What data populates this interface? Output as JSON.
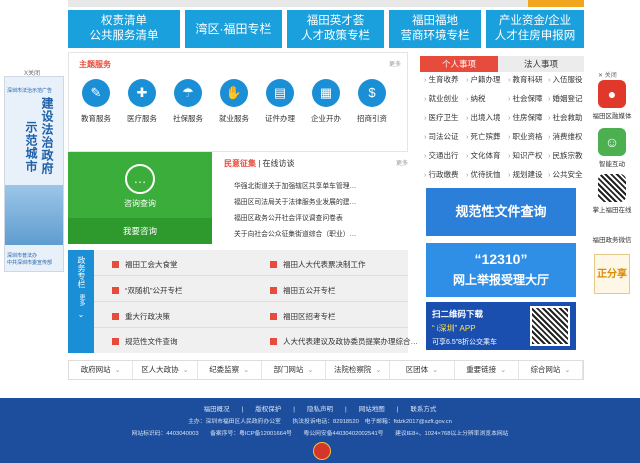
{
  "banners": [
    {
      "line1": "权责清单",
      "line2": "公共服务清单"
    },
    {
      "line1": "湾区·福田专栏",
      "line2": ""
    },
    {
      "line1": "福田英才荟",
      "line2": "人才政策专栏"
    },
    {
      "line1": "福田福地",
      "line2": "营商环境专栏"
    },
    {
      "line1": "产业资金/企业",
      "line2": "人才住房申报网"
    }
  ],
  "theme_services": {
    "title": "主题服务",
    "more": "更多",
    "items": [
      {
        "label": "教育服务",
        "icon": "graduation-icon"
      },
      {
        "label": "医疗服务",
        "icon": "medical-icon"
      },
      {
        "label": "社保服务",
        "icon": "social-security-icon"
      },
      {
        "label": "就业服务",
        "icon": "handshake-icon"
      },
      {
        "label": "证件办理",
        "icon": "certificate-icon"
      },
      {
        "label": "企业开办",
        "icon": "building-icon"
      },
      {
        "label": "招商引资",
        "icon": "money-bag-icon"
      }
    ]
  },
  "consult": {
    "title": "咨询查询",
    "bar": "我要咨询"
  },
  "opinions": {
    "title_red": "民意征集",
    "title_rest": " | 在线访谈",
    "more": "更多",
    "items": [
      "华强北街道关于加强辖区共享单车管理…",
      "福田区司法局关于法律服务业发展的建…",
      "福田区政务公开社会评议调查问卷表",
      "关于向社会公众征集街道综合（职业）…"
    ]
  },
  "gov_affairs": {
    "side_label": "政务专栏",
    "more": "更多",
    "items": [
      "福田工会大食堂",
      "福田人大代表票决制工作",
      "“双随机”公开专栏",
      "福田五公开专栏",
      "重大行政决策",
      "福田区招考专栏",
      "规范性文件查询",
      "人大代表建议及政协委员提案办理综合…"
    ]
  },
  "tabs": {
    "personal": "个人事项",
    "legal": "法人事项"
  },
  "personal_items": [
    "生育收养",
    "户籍办理",
    "教育科研",
    "入伍服役",
    "就业创业",
    "纳税",
    "社会保障",
    "婚姻登记",
    "医疗卫生",
    "出境入境",
    "住房保障",
    "社会救助",
    "司法公证",
    "死亡殡葬",
    "职业资格",
    "消费维权",
    "交通出行",
    "文化体育",
    "知识产权",
    "民族宗教",
    "行政缴费",
    "优待抚恤",
    "规划建设",
    "公共安全"
  ],
  "promo": {
    "b1": "规范性文件查询",
    "b2_line1": "“12310”",
    "b2_line2": "网上举报受理大厅",
    "b3_line1": "扫二维码下载",
    "b3_line2": "“ i深圳” APP",
    "b3_line3": "可享6.5”8折公交乘车"
  },
  "left_ad": {
    "close": "X关闭",
    "top": "深圳市法治示范广告",
    "col1": "建设法治政府",
    "col2": "示范城市",
    "foot1": "深圳市普法办",
    "foot2": "中共深圳市委宣传部"
  },
  "right_side": {
    "close": "关闭",
    "w1": "福田区融媒体",
    "w2": "智能互动",
    "w3": "掌上福田在线",
    "w4": "福田政务微信",
    "zfx": "正分享"
  },
  "bottom_nav": [
    "政府网站",
    "区人大政协",
    "纪委监察",
    "部门网站",
    "法院检察院",
    "区团体",
    "重要链接",
    "综合网站"
  ],
  "footer": {
    "links": [
      "福田概况",
      "版权保护",
      "隐私声明",
      "网站地图",
      "联系方式"
    ],
    "line1": "主办：深圳市福田区人民政府办公室　　执法投诉电话：82918520　电子邮箱：ftdzk2017@szft.gov.cn",
    "line2": "网站标识码：4403040003　　备案序号：粤ICP备12001664号　　粤公网安备44030402002541号　　建议IE8+、1024×768以上分辨率浏览本网站"
  },
  "colors": {
    "primary_blue": "#1aa0dc",
    "accent_red": "#e64b3b",
    "green": "#3bad3b",
    "footer_blue": "#1d4e9e"
  }
}
